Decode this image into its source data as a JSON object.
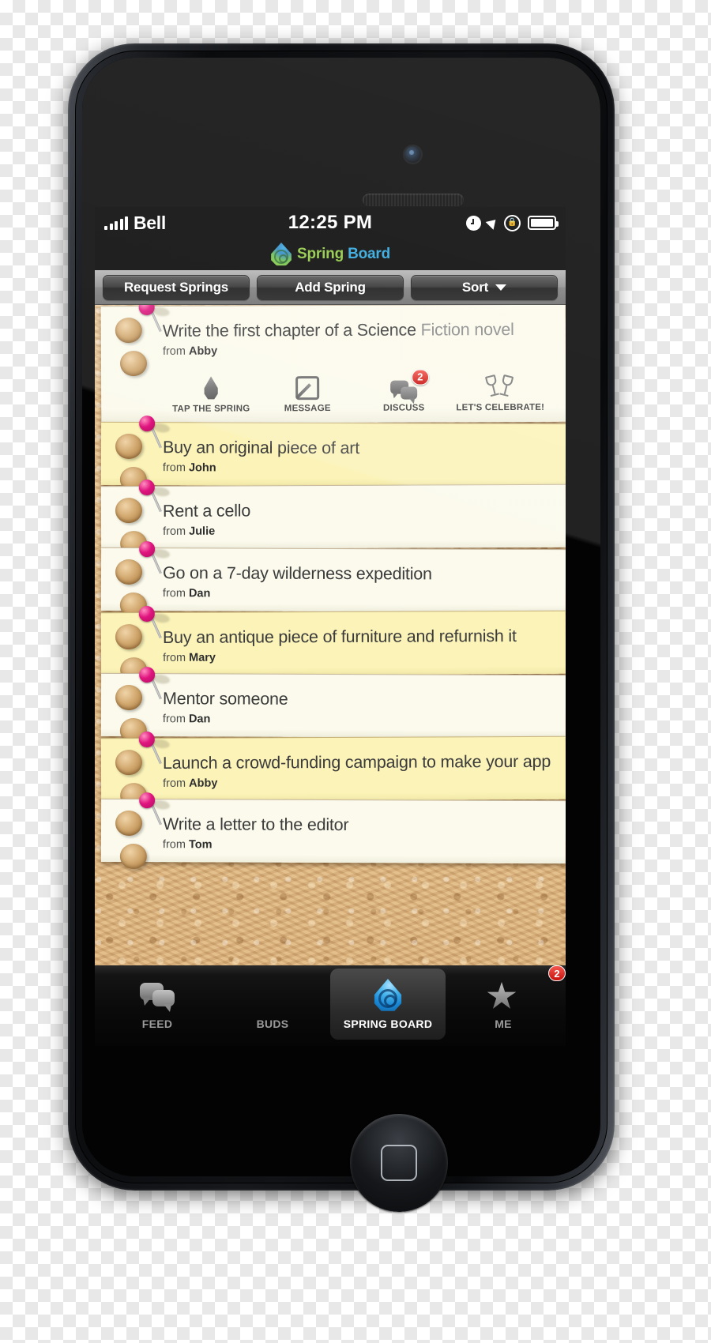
{
  "status_bar": {
    "carrier": "Bell",
    "time": "12:25 PM",
    "signal_bars": 5,
    "icons": [
      "alarm-clock-icon",
      "location-arrow-icon",
      "rotation-lock-icon",
      "battery-icon"
    ]
  },
  "app_header": {
    "logo_icon": "spring-drop-logo-icon",
    "title_part1": "Spring",
    "title_part2": "Board"
  },
  "toolbar": {
    "request_springs_label": "Request Springs",
    "add_spring_label": "Add Spring",
    "sort_label": "Sort",
    "sort_caret_icon": "chevron-down-icon"
  },
  "cards": [
    {
      "title_main": "Write the first chapter of a Science ",
      "title_dim": "Fiction novel",
      "from_prefix": "from ",
      "from_name": "Abby",
      "expanded": true,
      "shade": "cream",
      "actions": [
        {
          "icon": "water-drop-icon",
          "label": "TAP THE SPRING",
          "badge": null
        },
        {
          "icon": "compose-pencil-icon",
          "label": "MESSAGE",
          "badge": null
        },
        {
          "icon": "speech-bubbles-icon",
          "label": "DISCUSS",
          "badge": "2"
        },
        {
          "icon": "champagne-glasses-icon",
          "label": "LET'S CELEBRATE!",
          "badge": null
        }
      ]
    },
    {
      "title_main": "Buy an original piece of art",
      "title_dim": "",
      "from_prefix": "from ",
      "from_name": "John",
      "expanded": false,
      "shade": "yellow"
    },
    {
      "title_main": "Rent a cello",
      "title_dim": "",
      "from_prefix": "from ",
      "from_name": "Julie",
      "expanded": false,
      "shade": "cream"
    },
    {
      "title_main": "Go on a 7-day wilderness expedition",
      "title_dim": "",
      "from_prefix": "from ",
      "from_name": "Dan",
      "expanded": false,
      "shade": "cream"
    },
    {
      "title_main": "Buy an antique piece of furniture and refurnish it",
      "title_dim": "",
      "from_prefix": "from ",
      "from_name": "Mary",
      "expanded": false,
      "shade": "yellow"
    },
    {
      "title_main": "Mentor someone",
      "title_dim": "",
      "from_prefix": "from ",
      "from_name": "Dan",
      "expanded": false,
      "shade": "cream"
    },
    {
      "title_main": "Launch a crowd-funding campaign to make your app",
      "title_dim": "",
      "from_prefix": "from ",
      "from_name": "Abby",
      "expanded": false,
      "shade": "yellow"
    },
    {
      "title_main": "Write a letter to the editor",
      "title_dim": "",
      "from_prefix": "from ",
      "from_name": "Tom",
      "expanded": false,
      "shade": "cream"
    }
  ],
  "tab_bar": {
    "tabs": [
      {
        "label": "FEED",
        "icon": "speech-bubbles-icon",
        "active": false,
        "badge": null
      },
      {
        "label": "BUDS",
        "icon": "people-icon",
        "active": false,
        "badge": null
      },
      {
        "label": "SPRING BOARD",
        "icon": "spring-drop-icon",
        "active": true,
        "badge": null
      },
      {
        "label": "ME",
        "icon": "star-icon",
        "active": false,
        "badge": "2"
      }
    ]
  },
  "colors": {
    "logo_green": "#8dc63f",
    "logo_blue": "#29a3dc",
    "pin_pink": "#e0157f",
    "badge_red": "#c8110c",
    "card_cream": "#fbfaec",
    "card_yellow": "#fbf3b8",
    "cork": "#dcb47f"
  }
}
